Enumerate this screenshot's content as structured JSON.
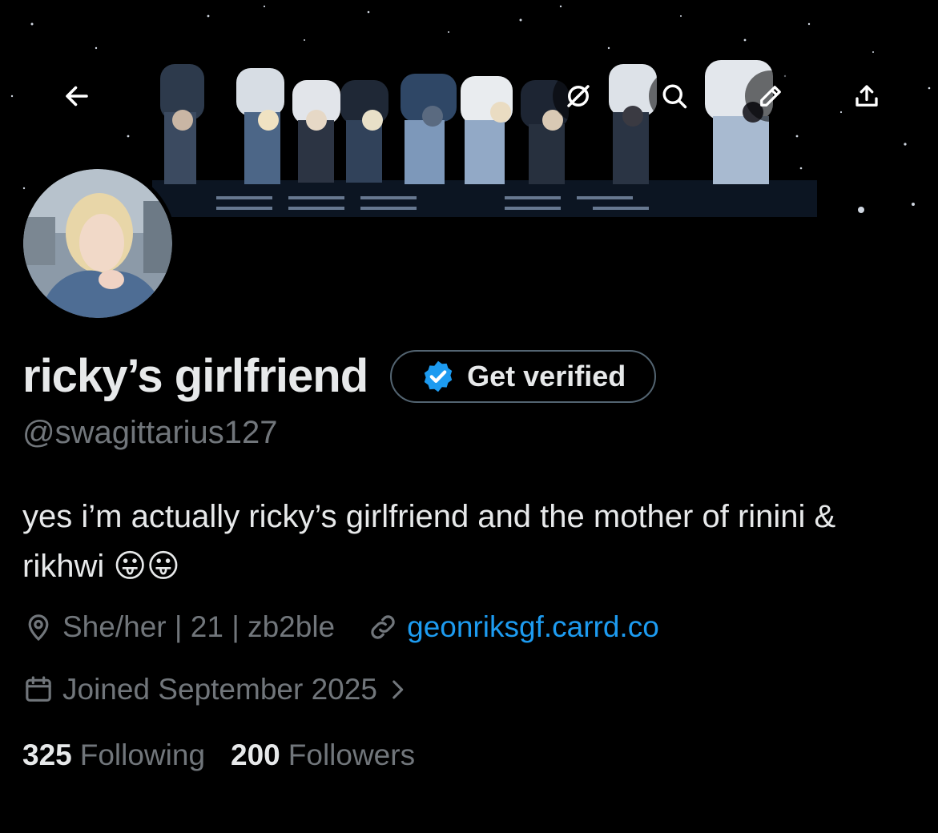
{
  "header": {
    "back_icon": "arrow-left-icon",
    "grok_icon": "grok-icon",
    "search_icon": "search-icon",
    "edit_icon": "pencil-icon",
    "share_icon": "share-icon"
  },
  "profile": {
    "display_name": "ricky’s girlfriend",
    "verify_label": "Get verified",
    "handle": "@swagittarius127",
    "bio": "yes i’m actually ricky’s girlfriend and the mother of rinini & rikhwi 😛😛",
    "location": "She/her | 21 | zb2ble",
    "website": "geonriksgf.carrd.co",
    "joined": "Joined September 2025"
  },
  "stats": {
    "following_count": "325",
    "following_label": "Following",
    "followers_count": "200",
    "followers_label": "Followers"
  },
  "colors": {
    "background": "#000000",
    "text_primary": "#e7e9ea",
    "text_secondary": "#71767b",
    "accent": "#1d9bf0",
    "border": "#536471"
  }
}
